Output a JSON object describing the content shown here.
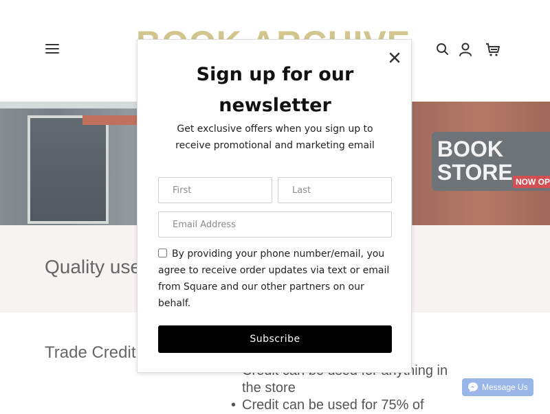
{
  "header": {
    "brand": "BOOK ARCHIVE",
    "icons": [
      "menu-icon",
      "search-icon",
      "account-icon",
      "cart-icon"
    ]
  },
  "hero": {
    "sign_line1": "BOOK",
    "sign_line2": "STORE",
    "sign_banner": "NOW OPEN"
  },
  "page": {
    "tagline": "Quality used books",
    "trade_title": "Trade Credit",
    "credit_items": [
      "Credit can be used for anything in the store",
      "Credit can be used for 75% of"
    ]
  },
  "modal": {
    "title": "Sign up for our newsletter",
    "subtitle": "Get exclusive offers when you sign up to receive promotional and marketing email",
    "first_placeholder": "First",
    "last_placeholder": "Last",
    "email_placeholder": "Email Address",
    "consent_text": "By providing your phone number/email, you agree to receive order updates via text or email from Square and our other partners on our behalf.",
    "consent_checked": false,
    "subscribe_label": "Subscribe",
    "close_icon": "close-icon"
  },
  "messenger": {
    "label": "Message Us",
    "icon": "messenger-icon"
  },
  "colors": {
    "brand": "#d2c58e",
    "band": "#f7f3f2",
    "button": "#000000",
    "messenger": "#9ab5e8"
  }
}
